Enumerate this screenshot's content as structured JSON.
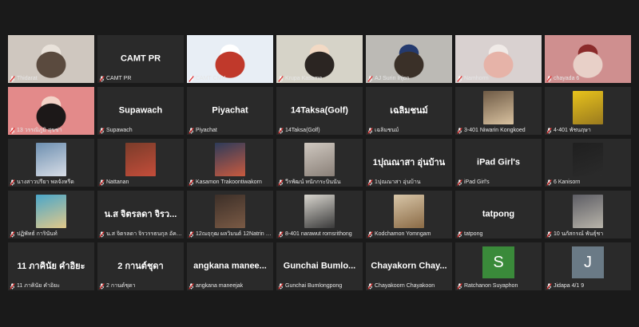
{
  "participants": [
    {
      "display": "video",
      "name": "Thidarat",
      "muted": true,
      "colors": [
        "#cfc7bf",
        "#5a4a3e",
        "#e9e2da"
      ]
    },
    {
      "display": "name",
      "name": "CAMT PR",
      "muted": true
    },
    {
      "display": "video",
      "name": "CAMT CMU",
      "muted": true,
      "colors": [
        "#e8eef5",
        "#c0392b",
        "#ffffff"
      ]
    },
    {
      "display": "video",
      "name": "Krupa Kasame",
      "muted": true,
      "active": true,
      "colors": [
        "#d6d3c8",
        "#2b2522",
        "#f2d9c4"
      ]
    },
    {
      "display": "video",
      "name": "AJ Surin Injon",
      "muted": true,
      "colors": [
        "#bcbab5",
        "#3a3028",
        "#243a6e"
      ]
    },
    {
      "display": "video",
      "name": "Namhorm",
      "muted": true,
      "colors": [
        "#d9d1d0",
        "#e6b3a8",
        "#f0eae7"
      ]
    },
    {
      "display": "video",
      "name": "chayada 6",
      "muted": true,
      "colors": [
        "#cf8f8f",
        "#e8d0c8",
        "#8a2a2a"
      ]
    },
    {
      "display": "video",
      "name": "13 วรรณิภูมิ สุขข่า",
      "muted": true,
      "colors": [
        "#e38a8a",
        "#1c1818",
        "#f3d3c8"
      ]
    },
    {
      "display": "name",
      "name": "Supawach",
      "muted": true
    },
    {
      "display": "name",
      "name": "Piyachat",
      "muted": true
    },
    {
      "display": "name",
      "name": "14Taksa(Golf)",
      "muted": true
    },
    {
      "display": "name",
      "name": "เฉลิมชนม์",
      "muted": true
    },
    {
      "display": "pic",
      "name": "3-401 Niwarin Kongkoed",
      "muted": true,
      "colors": [
        "#6e5a45",
        "#d9c2a0"
      ]
    },
    {
      "display": "pic",
      "name": "4-401 พัชนฤษา",
      "muted": true,
      "colors": [
        "#e8c31c",
        "#9a7a1e"
      ]
    },
    {
      "display": "pic",
      "name": "นางสาวปรียา พลจังหรีด",
      "muted": true,
      "colors": [
        "#6d8fb0",
        "#d8dde6"
      ]
    },
    {
      "display": "pic",
      "name": "Nattanan",
      "muted": true,
      "colors": [
        "#7a3c2a",
        "#c44d3a"
      ]
    },
    {
      "display": "pic",
      "name": "Kasamon Trakoontiwakorn",
      "muted": true,
      "colors": [
        "#2d3b5a",
        "#c95a3f"
      ]
    },
    {
      "display": "pic",
      "name": "วีรพัฒน์ หนักกระบินนัน",
      "muted": true,
      "colors": [
        "#cfc8c0",
        "#8a8078"
      ]
    },
    {
      "display": "name",
      "name": "1ปุณณาสา อุ่นบ้าน",
      "muted": true
    },
    {
      "display": "name",
      "name": "iPad Girl's",
      "muted": true
    },
    {
      "display": "pic",
      "name": "6 Kanisorn",
      "muted": true,
      "colors": [
        "#1f1f1f",
        "#2b2b2b"
      ]
    },
    {
      "display": "pic",
      "name": "ปฏิพัทธ์ การินันท์",
      "muted": true,
      "colors": [
        "#4aa6c9",
        "#e2c98a"
      ]
    },
    {
      "display": "name",
      "name": "น.ส จิตรลดา จิรว...",
      "tag": "น.ส จิตรลดา จิรวรรธนกุล อัครสัมพันธุ์...",
      "muted": true
    },
    {
      "display": "pic",
      "name": "12ณฤกุฒ ผลวิมนต์ 12Natrin M...",
      "muted": true,
      "colors": [
        "#3c2f28",
        "#7a5a45"
      ]
    },
    {
      "display": "pic",
      "name": "8-401 narawut romsrithong",
      "muted": true,
      "colors": [
        "#d9d6cf",
        "#3a3a3a"
      ]
    },
    {
      "display": "pic",
      "name": "Kodchamon Yomngam",
      "muted": true,
      "colors": [
        "#d8c6a8",
        "#8a6a45"
      ]
    },
    {
      "display": "name",
      "name": "tatpong",
      "muted": true
    },
    {
      "display": "pic",
      "name": "10 นภัสกรณ์ พันธุ์ชา",
      "muted": true,
      "colors": [
        "#5d5d64",
        "#b8b4aa"
      ]
    },
    {
      "display": "name",
      "name": "11 ภาคินัย คำอิยะ",
      "muted": true
    },
    {
      "display": "name",
      "name": "2 กานต์ชุดา",
      "muted": true
    },
    {
      "display": "name",
      "name": "angkana manee...",
      "tag": "angkana maneejak",
      "muted": true
    },
    {
      "display": "name",
      "name": "Gunchai Bumlo...",
      "tag": "Gunchai Bumlongpong",
      "muted": true
    },
    {
      "display": "name",
      "name": "Chayakorn Chay...",
      "tag": "Chayakoorn Chayakoon",
      "muted": true
    },
    {
      "display": "letter",
      "name": "Ratchanon Suyaphon",
      "letter": "S",
      "muted": true,
      "colors": [
        "#3a8a3a"
      ]
    },
    {
      "display": "letter",
      "name": "Jidapa 4/1 9",
      "letter": "J",
      "muted": true,
      "colors": [
        "#6a7a86"
      ]
    }
  ],
  "colors": {
    "muted_mic": "#e02828",
    "active_border": "#c8e645",
    "tile_bg": "#2a2a2a"
  },
  "icons": {
    "muted": "muted-mic-icon"
  }
}
